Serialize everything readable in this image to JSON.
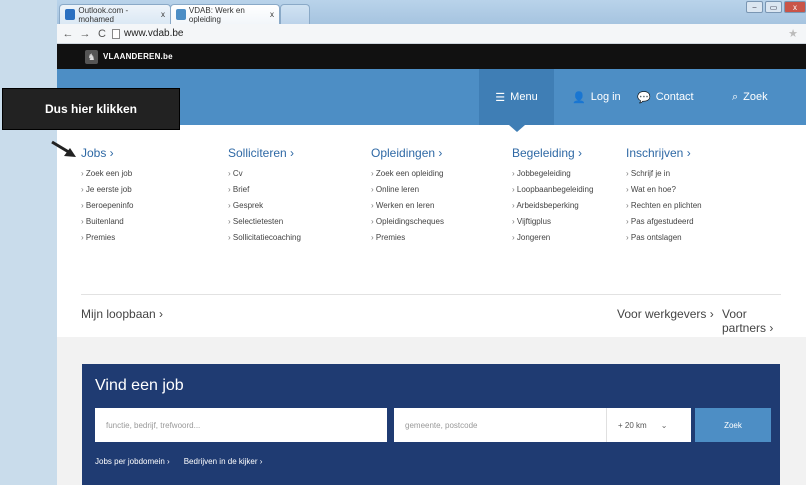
{
  "browser": {
    "tabs": [
      {
        "label": "Outlook.com - mohamed",
        "close": "x"
      },
      {
        "label": "VDAB: Werk en opleiding",
        "close": "x"
      }
    ],
    "url": "www.vdab.be",
    "window_controls": [
      "⎯",
      "▭",
      "x"
    ]
  },
  "site": {
    "topbar_label": "VLAANDEREN.be",
    "nav": {
      "menu": "Menu",
      "login": "Log in",
      "contact": "Contact",
      "search": "Zoek"
    }
  },
  "menu_columns": [
    {
      "heading": "Jobs ›",
      "items": [
        "Zoek een job",
        "Je eerste job",
        "Beroepeninfo",
        "Buitenland",
        "Premies"
      ]
    },
    {
      "heading": "Solliciteren ›",
      "items": [
        "Cv",
        "Brief",
        "Gesprek",
        "Selectietesten",
        "Sollicitatiecoaching"
      ]
    },
    {
      "heading": "Opleidingen ›",
      "items": [
        "Zoek een opleiding",
        "Online leren",
        "Werken en leren",
        "Opleidingscheques",
        "Premies"
      ]
    },
    {
      "heading": "Begeleiding ›",
      "items": [
        "Jobbegeleiding",
        "Loopbaanbegeleiding",
        "Arbeidsbeperking",
        "Vijftigplus",
        "Jongeren"
      ]
    },
    {
      "heading": "Inschrijven ›",
      "items": [
        "Schrijf je in",
        "Wat en hoe?",
        "Rechten en plichten",
        "Pas afgestudeerd",
        "Pas ontslagen"
      ]
    }
  ],
  "footer_links": {
    "loopbaan": "Mijn loopbaan ›",
    "werkgevers": "Voor werkgevers ›",
    "partners": "Voor partners ›"
  },
  "job_search": {
    "title": "Vind een job",
    "function_placeholder": "functie, bedrijf, trefwoord...",
    "location_placeholder": "gemeente, postcode",
    "distance": "+ 20 km",
    "button": "Zoek",
    "links": [
      "Jobs per jobdomein ›",
      "Bedrijven in de kijker ›"
    ]
  },
  "annotation": {
    "callout": "Dus hier klikken"
  }
}
